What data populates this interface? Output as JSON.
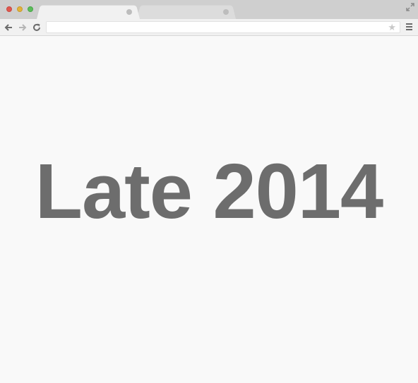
{
  "browser": {
    "tabs": [
      {
        "label": "",
        "active": true
      },
      {
        "label": "",
        "active": false
      }
    ],
    "address_bar": {
      "value": ""
    },
    "icons": [
      "close-window-icon",
      "minimize-window-icon",
      "maximize-window-icon",
      "expand-icon",
      "back-arrow-icon",
      "forward-arrow-icon",
      "reload-icon",
      "star-icon",
      "menu-icon"
    ]
  },
  "content": {
    "headline": "Late 2014"
  },
  "colors": {
    "headline": "#6d6d6d",
    "background": "#f9f9f9",
    "tabstrip": "#cfcfcf"
  }
}
